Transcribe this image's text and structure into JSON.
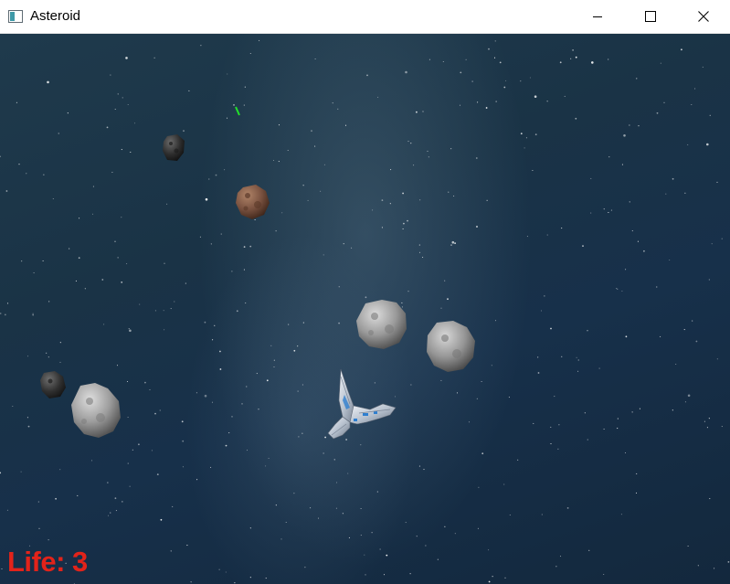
{
  "window": {
    "title": "Asteroid",
    "icon": "app-window-icon",
    "controls": [
      "minimize-icon",
      "maximize-icon",
      "close-icon"
    ]
  },
  "hud": {
    "life_text": "Life: 3",
    "life_color": "#e2231a"
  },
  "scene": {
    "background": "starfield-milky-way",
    "entities": [
      "player-ship",
      "laser-bolt",
      "asteroid-small-dark",
      "asteroid-small-brown",
      "asteroid-large-gray",
      "asteroid-large-gray",
      "asteroid-small-dark",
      "asteroid-large-gray"
    ],
    "laser_color": "#22e02a"
  }
}
